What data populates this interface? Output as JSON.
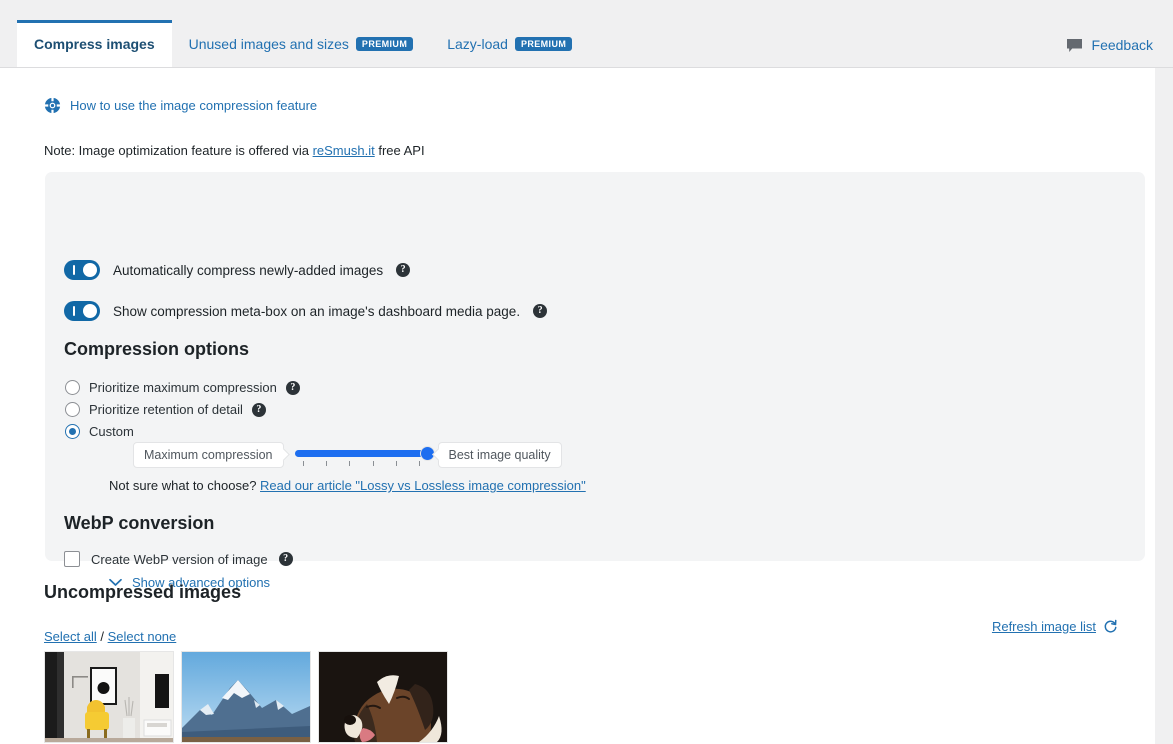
{
  "tabs": [
    {
      "label": "Compress images",
      "premium": null,
      "active": true,
      "name": "tab-compress-images"
    },
    {
      "label": "Unused images and sizes",
      "premium": "PREMIUM",
      "active": false,
      "name": "tab-unused-images-and-sizes"
    },
    {
      "label": "Lazy-load",
      "premium": "PREMIUM",
      "active": false,
      "name": "tab-lazy-load"
    }
  ],
  "feedback": {
    "label": "Feedback",
    "icon": "comment-icon"
  },
  "howto": {
    "label": "How to use the image compression feature",
    "icon": "lifebuoy-icon"
  },
  "note": {
    "prefix": "Note: Image optimization feature is offered via ",
    "link": "reSmush.it",
    "suffix": " free API"
  },
  "panel": {
    "toggles": [
      {
        "label": "Automatically compress newly-added images",
        "on": true,
        "help": "?"
      },
      {
        "label": "Show compression meta-box on an image's dashboard media page.",
        "on": true,
        "help": "?"
      }
    ],
    "compression_options": {
      "title": "Compression options",
      "radios": [
        {
          "label": "Prioritize maximum compression",
          "selected": false,
          "help": "?"
        },
        {
          "label": "Prioritize retention of detail",
          "selected": false,
          "help": "?"
        },
        {
          "label": "Custom",
          "selected": true,
          "help": null
        }
      ],
      "slider": {
        "min_label": "Maximum compression",
        "max_label": "Best image quality",
        "value": 6,
        "min": 1,
        "max": 6,
        "ticks": 6
      },
      "not_sure": {
        "text": "Not sure what to choose? ",
        "link": "Read our article \"Lossy vs Lossless image compression\""
      }
    },
    "webp": {
      "title": "WebP conversion",
      "checkbox": {
        "label": "Create WebP version of image",
        "checked": false,
        "help": "?"
      },
      "advanced_link": {
        "label": "Show advanced options",
        "icon": "chevron-down-icon"
      }
    }
  },
  "uncompressed": {
    "title": "Uncompressed images",
    "select_all": "Select all",
    "separator": " / ",
    "select_none": "Select none",
    "refresh": {
      "label": "Refresh image list",
      "icon": "refresh-icon"
    },
    "images": [
      {
        "alt": "interior-room-with-yellow-armchair"
      },
      {
        "alt": "snow-covered-mountain-peak"
      },
      {
        "alt": "brown-and-white-puppy"
      }
    ]
  },
  "colors": {
    "accent": "#2271b1",
    "toggle_on": "#1168a6",
    "slider": "#1d6ef0",
    "panel_bg": "#f3f4f5",
    "page_bg": "#f0f0f1"
  }
}
